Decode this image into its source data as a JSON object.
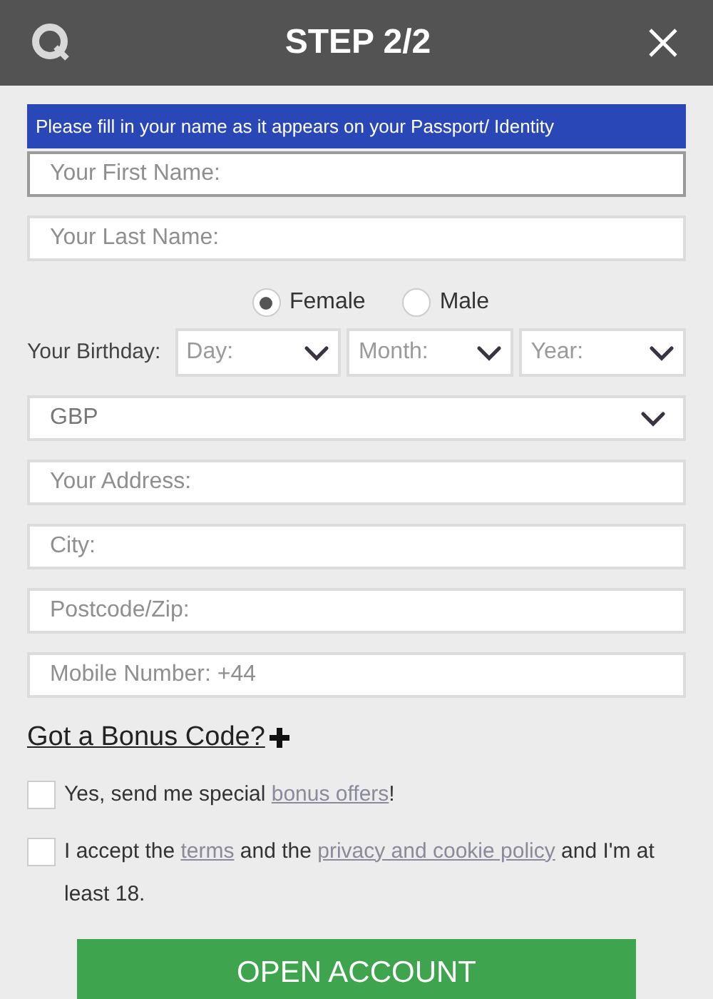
{
  "header": {
    "title": "STEP 2/2"
  },
  "notice": "Please fill in your name as it appears on your Passport/ Identity",
  "name_fields": [
    {
      "placeholder": "Your First Name:",
      "focused": true
    },
    {
      "placeholder": "Your Last Name:",
      "focused": false
    }
  ],
  "gender": [
    {
      "label": "Female",
      "selected": true
    },
    {
      "label": "Male",
      "selected": false
    }
  ],
  "birthday": {
    "label": "Your Birthday:",
    "selects": [
      "Day:",
      "Month:",
      "Year:"
    ]
  },
  "currency": {
    "value": "GBP"
  },
  "fields": [
    {
      "placeholder": "Your Address:"
    },
    {
      "placeholder": "City:"
    },
    {
      "placeholder": "Postcode/Zip:"
    },
    {
      "placeholder": "Mobile Number: +44"
    }
  ],
  "bonus_link": "Got a Bonus Code?",
  "checkboxes": [
    {
      "checked": false,
      "parts": [
        {
          "kind": "text",
          "text": "Yes, send me special "
        },
        {
          "kind": "link",
          "text": "bonus offers"
        },
        {
          "kind": "text",
          "text": "!"
        }
      ]
    },
    {
      "checked": false,
      "parts": [
        {
          "kind": "text",
          "text": "I accept the "
        },
        {
          "kind": "link",
          "text": "terms"
        },
        {
          "kind": "text",
          "text": " and the "
        },
        {
          "kind": "link",
          "text": "privacy and cookie policy"
        },
        {
          "kind": "text",
          "text": " and I'm at least 18."
        }
      ]
    }
  ],
  "submit": "OPEN ACCOUNT"
}
